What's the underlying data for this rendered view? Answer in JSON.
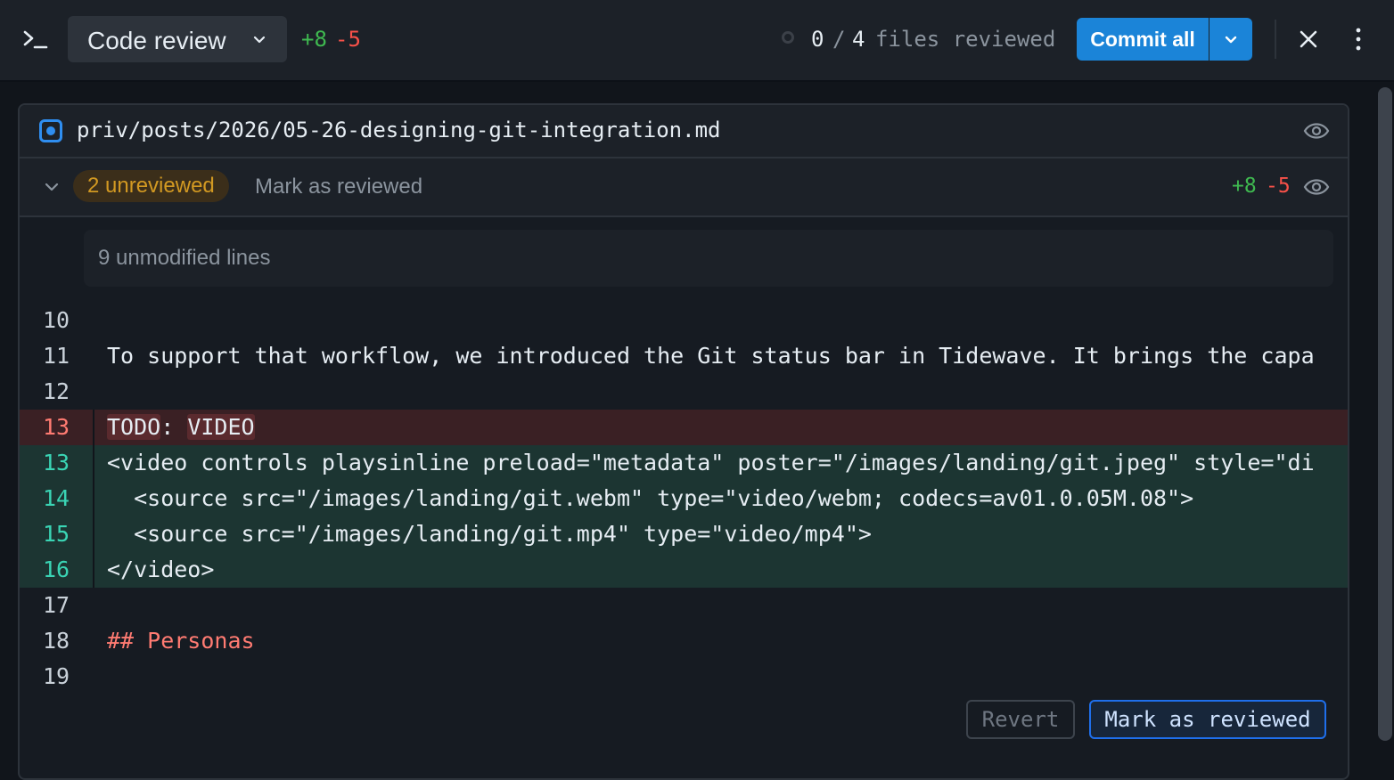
{
  "header": {
    "title": "Code review",
    "additions": "+8",
    "deletions": "-5",
    "reviewed_count": "0",
    "reviewed_sep": "/",
    "reviewed_total": "4",
    "reviewed_label": "files reviewed",
    "commit_label": "Commit all"
  },
  "file": {
    "path": "priv/posts/2026/05-26-designing-git-integration.md",
    "badge": "2 unreviewed",
    "mark_link": "Mark as reviewed",
    "additions": "+8",
    "deletions": "-5",
    "unmodified": "9 unmodified lines"
  },
  "lines": [
    {
      "num": "10",
      "text": "",
      "type": "context"
    },
    {
      "num": "11",
      "text": "To support that workflow, we introduced the Git status bar in Tidewave. It brings the capa",
      "type": "context"
    },
    {
      "num": "12",
      "text": "",
      "type": "context"
    },
    {
      "num": "13",
      "text_a": "TODO",
      "text_b": ": ",
      "text_c": "VIDEO",
      "type": "deleted"
    },
    {
      "num": "13",
      "text": "<video controls playsinline preload=\"metadata\" poster=\"/images/landing/git.jpeg\" style=\"di",
      "type": "added"
    },
    {
      "num": "14",
      "text": "  <source src=\"/images/landing/git.webm\" type=\"video/webm; codecs=av01.0.05M.08\">",
      "type": "added"
    },
    {
      "num": "15",
      "text": "  <source src=\"/images/landing/git.mp4\" type=\"video/mp4\">",
      "type": "added"
    },
    {
      "num": "16",
      "text": "</video>",
      "type": "added"
    },
    {
      "num": "17",
      "text": "",
      "type": "context"
    },
    {
      "num": "18",
      "text": "## Personas",
      "type": "context"
    },
    {
      "num": "19",
      "text": "",
      "type": "context"
    }
  ],
  "footer": {
    "revert_label": "Revert",
    "mark_label": "Mark as reviewed"
  },
  "colors": {
    "accent": "#1b84d8",
    "added": "#3fb950",
    "deleted": "#f85149",
    "badge": "#d29922"
  },
  "icons": [
    "terminal-icon",
    "chevron-down-icon",
    "close-icon",
    "more-vertical-icon",
    "eye-icon",
    "checkbox-icon"
  ]
}
